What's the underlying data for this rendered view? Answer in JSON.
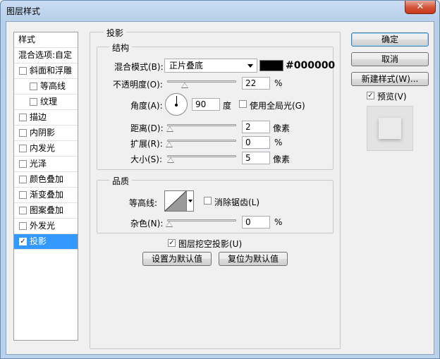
{
  "window": {
    "title": "图层样式",
    "close_glyph": "✕"
  },
  "style_list": {
    "header": "样式",
    "blend_options": "混合选项:自定",
    "items": [
      {
        "label": "斜面和浮雕",
        "checked": false,
        "sub": false
      },
      {
        "label": "等高线",
        "checked": false,
        "sub": true
      },
      {
        "label": "纹理",
        "checked": false,
        "sub": true
      },
      {
        "label": "描边",
        "checked": false,
        "sub": false
      },
      {
        "label": "内阴影",
        "checked": false,
        "sub": false
      },
      {
        "label": "内发光",
        "checked": false,
        "sub": false
      },
      {
        "label": "光泽",
        "checked": false,
        "sub": false
      },
      {
        "label": "颜色叠加",
        "checked": false,
        "sub": false
      },
      {
        "label": "渐变叠加",
        "checked": false,
        "sub": false
      },
      {
        "label": "图案叠加",
        "checked": false,
        "sub": false
      },
      {
        "label": "外发光",
        "checked": false,
        "sub": false
      },
      {
        "label": "投影",
        "checked": true,
        "sub": false,
        "selected": true
      }
    ]
  },
  "drop_shadow": {
    "section_title": "投影",
    "structure": {
      "title": "结构",
      "blend_mode_label": "混合模式(B):",
      "blend_mode_value": "正片叠底",
      "color_hex": "#000000",
      "opacity_label": "不透明度(O):",
      "opacity_value": "22",
      "opacity_unit": "%",
      "angle_label": "角度(A):",
      "angle_value": "90",
      "angle_unit": "度",
      "global_light_label": "使用全局光(G)",
      "global_light_checked": false,
      "distance_label": "距离(D):",
      "distance_value": "2",
      "distance_unit": "像素",
      "spread_label": "扩展(R):",
      "spread_value": "0",
      "spread_unit": "%",
      "size_label": "大小(S):",
      "size_value": "5",
      "size_unit": "像素"
    },
    "quality": {
      "title": "品质",
      "contour_label": "等高线:",
      "antialias_label": "消除锯齿(L)",
      "antialias_checked": false,
      "noise_label": "杂色(N):",
      "noise_value": "0",
      "noise_unit": "%"
    },
    "knockout_label": "图层挖空投影(U)",
    "knockout_checked": true,
    "make_default": "设置为默认值",
    "reset_default": "复位为默认值"
  },
  "slider_levels_percent": {
    "opacity": 22,
    "distance": 0.7,
    "spread": 0,
    "size": 2
  },
  "buttons": {
    "ok": "确定",
    "cancel": "取消",
    "new_style": "新建样式(W)...",
    "preview_label": "预览(V)",
    "preview_checked": true
  },
  "colors": {
    "selection": "#3399ff",
    "shadow_color": "#000000"
  },
  "check_glyph": "✓"
}
